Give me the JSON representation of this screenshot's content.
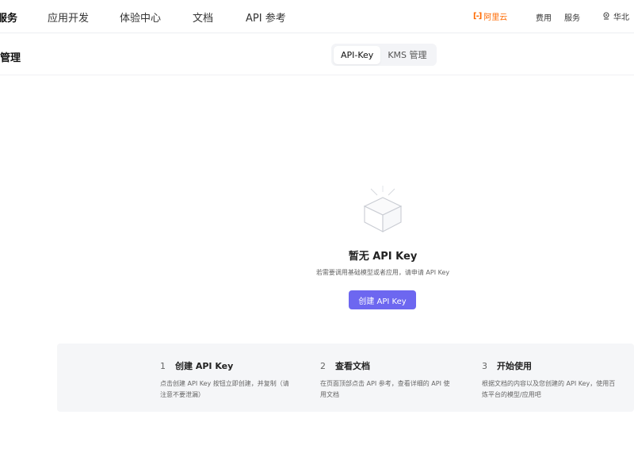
{
  "topnav": {
    "items": [
      "服务",
      "应用开发",
      "体验中心",
      "文档",
      "API 参考"
    ],
    "brand": "阿里云",
    "brand_logo": "[-]",
    "utils": [
      "费用",
      "服务"
    ],
    "region": "华北"
  },
  "subheader": {
    "title": "管理",
    "tabs": [
      "API-Key",
      "KMS 管理"
    ]
  },
  "empty": {
    "icon": "empty-box-icon",
    "title": "暂无 API Key",
    "description": "若需要调用基础模型或者应用，请申请 API Key",
    "button": "创建 API Key"
  },
  "steps": [
    {
      "num": "1",
      "title": "创建 API Key",
      "description": "点击创建 API Key 按钮立即创建，并复制（请注意不要泄漏）"
    },
    {
      "num": "2",
      "title": "查看文档",
      "description": "在页面顶部点击 API 参考，查看详细的 API 使用文档"
    },
    {
      "num": "3",
      "title": "开始使用",
      "description": "根据文档的内容以及您创建的 API Key，使用百炼平台的模型/应用吧"
    }
  ],
  "colors": {
    "accent": "#6d67f0",
    "brand": "#ff6a00",
    "panel": "#f5f6f8"
  }
}
